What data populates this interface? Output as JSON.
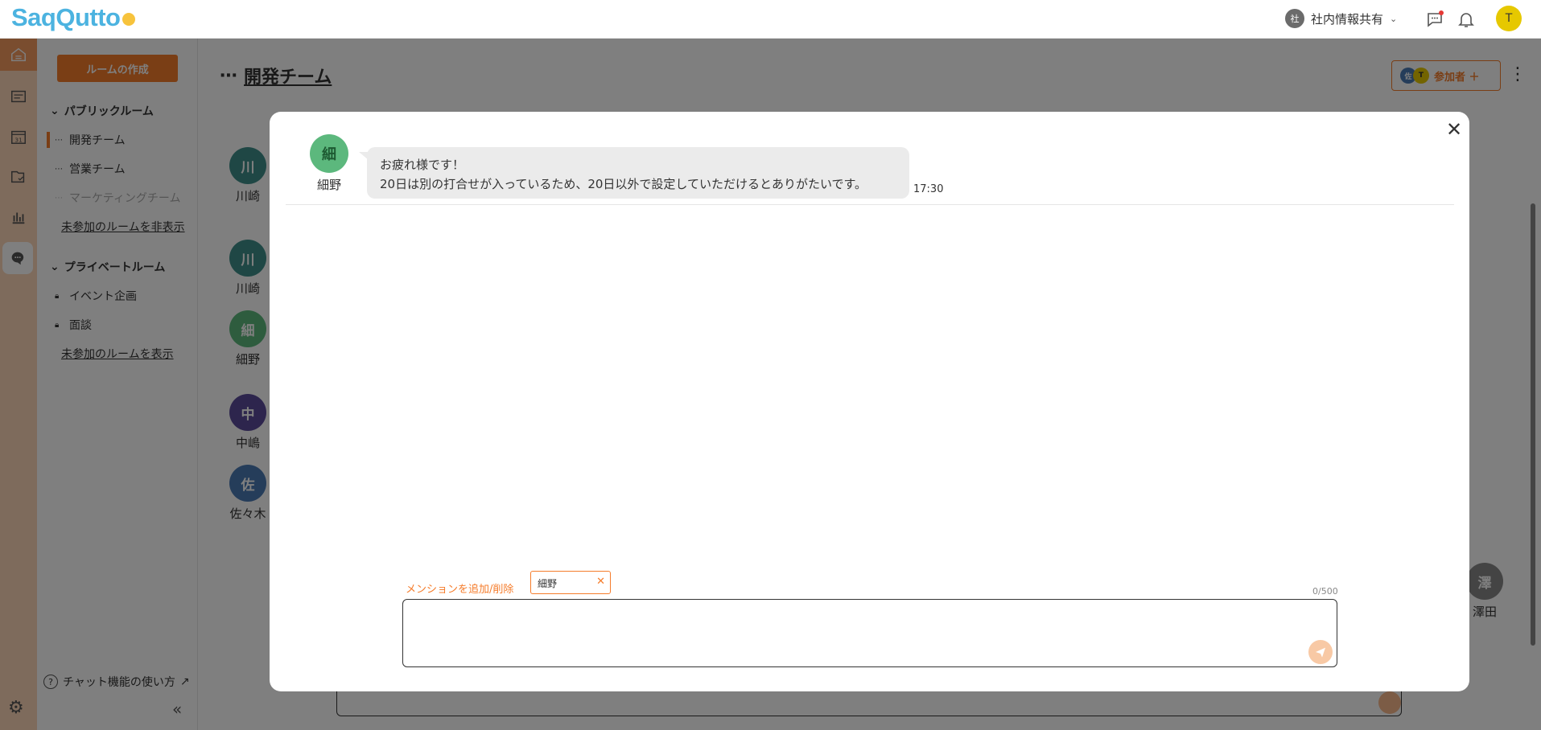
{
  "app": {
    "logo": "SaqQutto"
  },
  "header": {
    "company_badge": "社",
    "company_name": "社内情報共有",
    "user_initial": "T"
  },
  "sidebar": {
    "create_room": "ルームの作成",
    "public_section": "パブリックルーム",
    "public_rooms": [
      "開発チーム",
      "営業チーム",
      "マーケティングチーム"
    ],
    "hide_unjoined": "未参加のルームを非表示",
    "private_section": "プライベートルーム",
    "private_rooms": [
      "イベント企画",
      "面談"
    ],
    "show_unjoined": "未参加のルームを表示",
    "help": "チャット機能の使い方"
  },
  "room": {
    "title": "開発チーム",
    "participants_label": "参加者 ＋",
    "participant_avatars": [
      "佐",
      "T"
    ]
  },
  "members": [
    {
      "initial": "川",
      "name": "川崎"
    },
    {
      "initial": "川",
      "name": "川崎"
    },
    {
      "initial": "細",
      "name": "細野"
    },
    {
      "initial": "中",
      "name": "中嶋"
    },
    {
      "initial": "佐",
      "name": "佐々木"
    },
    {
      "initial": "澤",
      "name": "澤田"
    }
  ],
  "modal": {
    "message": {
      "avatar": "細",
      "sender": "細野",
      "line1": "お疲れ様です！",
      "line2": "20日は別の打合せが入っているため、20日以外で設定していただけるとありがたいです。",
      "time": "17:30"
    },
    "mention_label": "メンションを追加/削除",
    "mention_tag": "細野",
    "counter": "0/500"
  },
  "colors": {
    "accent": "#f57c2b",
    "rail": "#fdd6b8"
  }
}
